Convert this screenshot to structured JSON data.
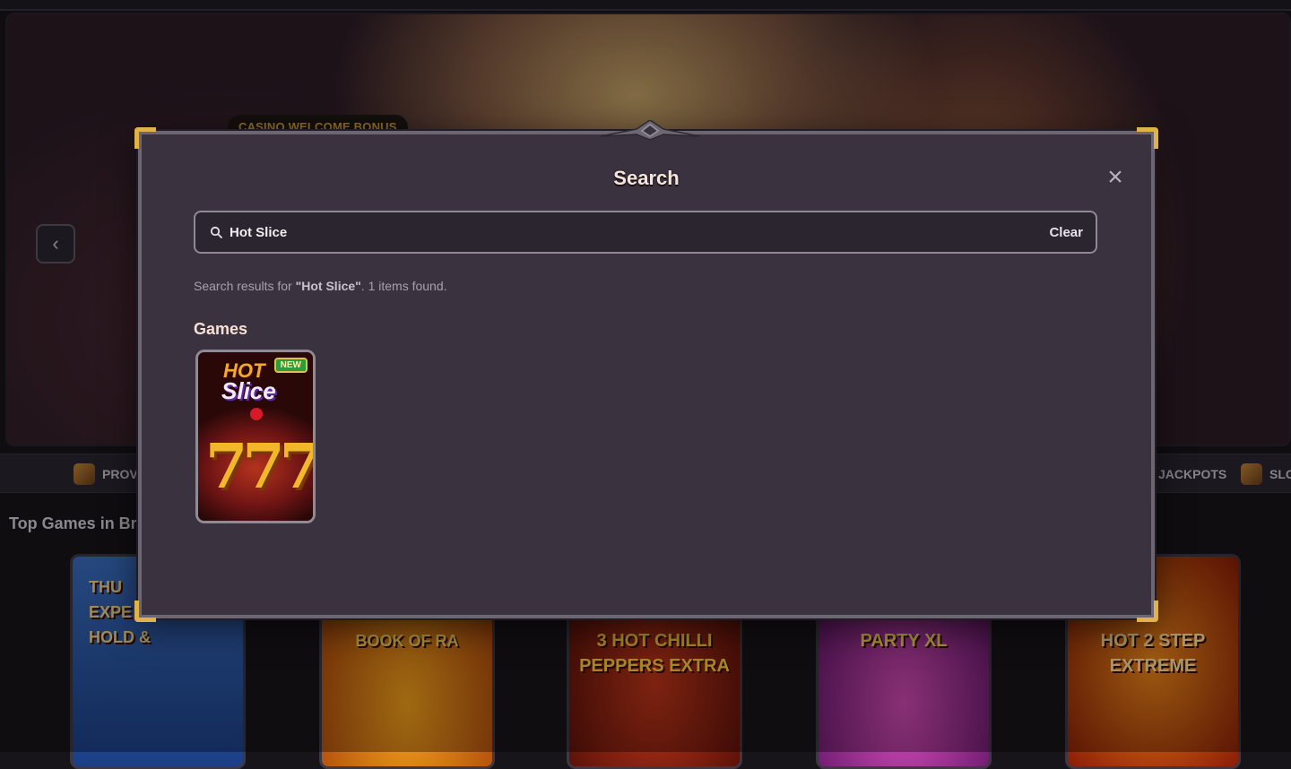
{
  "background": {
    "hero": {
      "bonus_label": "CASINO WELCOME BONUS"
    },
    "nav": [
      {
        "label": "PROV"
      },
      {
        "label": "JACKPOTS"
      },
      {
        "label": "SLO"
      }
    ],
    "section_title": "Top Games in Bra",
    "tiles": [
      {
        "label": "THU\nEXPE\nHOLD &"
      },
      {
        "label": "BOOK OF RA"
      },
      {
        "label": "3 HOT CHILLI PEPPERS EXTRA"
      },
      {
        "label": "PARTY XL"
      },
      {
        "label": "HOT 2 STEP EXTREME"
      }
    ]
  },
  "modal": {
    "title": "Search",
    "close_icon": "close-icon",
    "search": {
      "value": "Hot Slice",
      "clear_label": "Clear"
    },
    "results": {
      "prefix": "Search results for ",
      "query_quoted": "\"Hot Slice\"",
      "suffix": ". 1 items found."
    },
    "games_heading": "Games",
    "games": [
      {
        "title_top": "HOT",
        "title_main": "Slice",
        "badge": "NEW",
        "art": "777"
      }
    ]
  },
  "colors": {
    "modal_bg": "#3b323f",
    "gold_accent": "#e0b247",
    "title_text": "#f5e6dc"
  }
}
